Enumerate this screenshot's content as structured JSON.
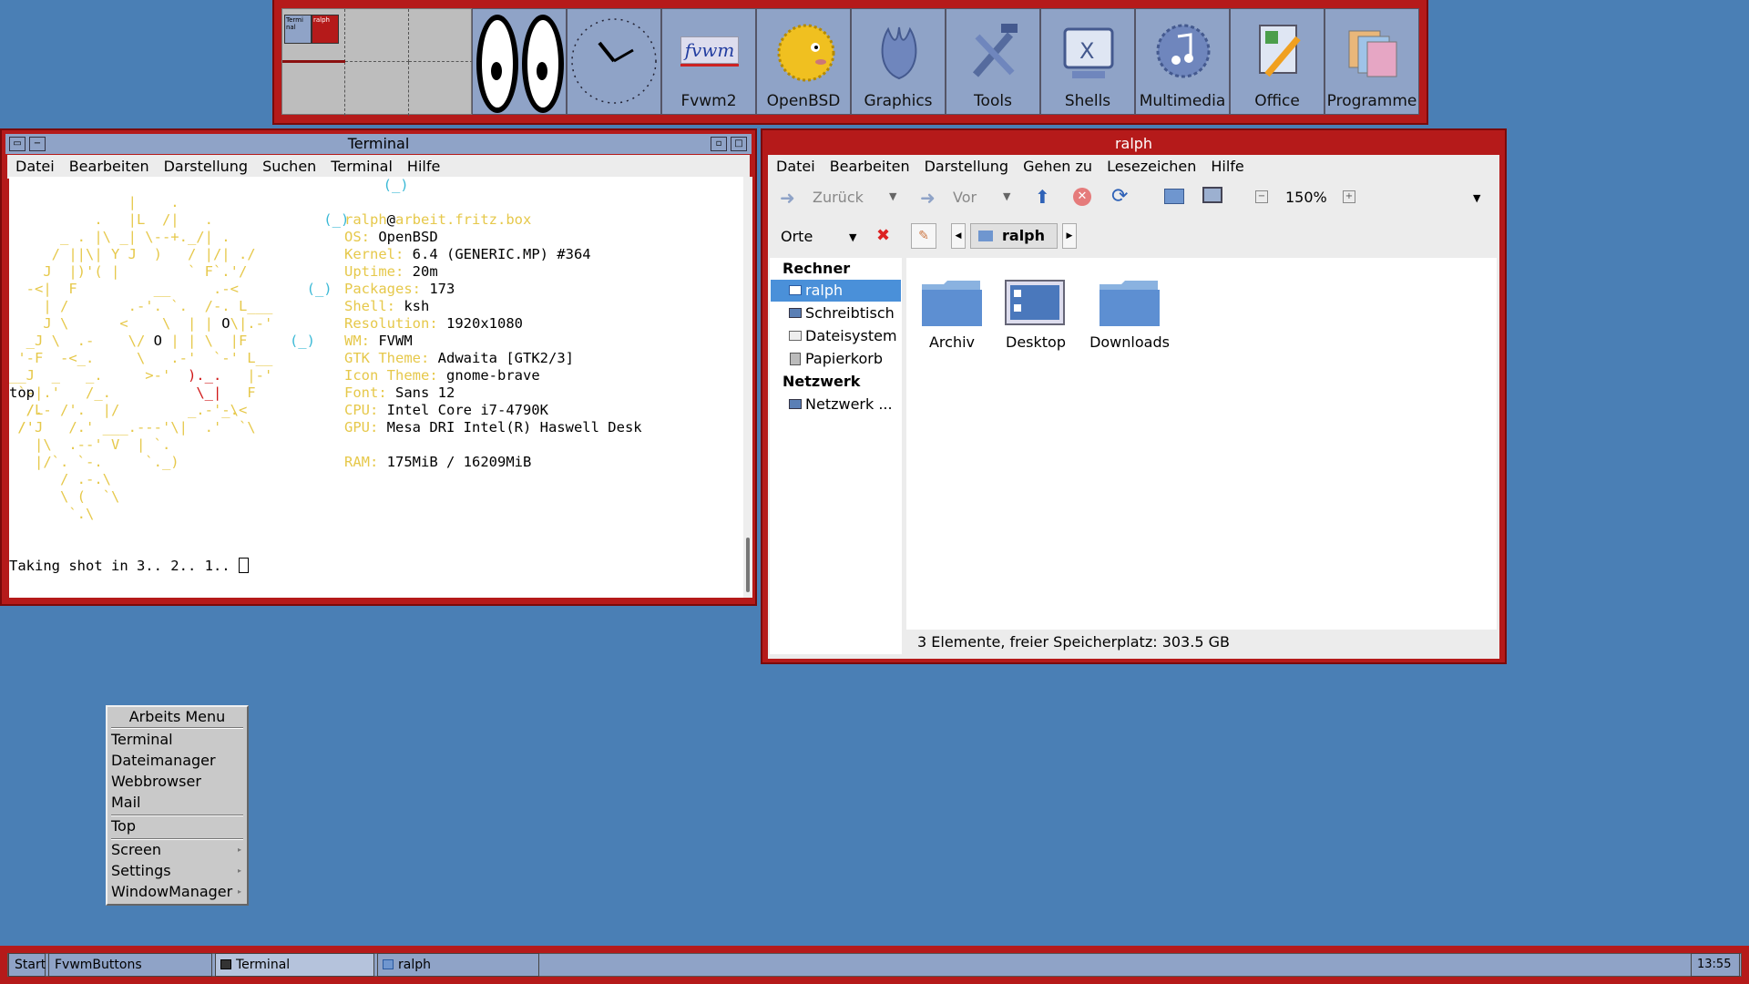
{
  "panel": {
    "pager": {
      "mini_terminal": "Termi nal",
      "mini_ralph": "ralph"
    },
    "buttons": [
      {
        "label": "Fvwm2",
        "icon": "fvwm-logo-icon"
      },
      {
        "label": "OpenBSD",
        "icon": "puffy-fish-icon"
      },
      {
        "label": "Graphics",
        "icon": "graphics-flower-icon"
      },
      {
        "label": "Tools",
        "icon": "tools-icon"
      },
      {
        "label": "Shells",
        "icon": "shells-monitor-icon"
      },
      {
        "label": "Multimedia",
        "icon": "multimedia-note-icon"
      },
      {
        "label": "Office",
        "icon": "office-pen-icon"
      },
      {
        "label": "Programme",
        "icon": "programs-folders-icon"
      }
    ],
    "fvwm_logo_text": "fvwm"
  },
  "terminal": {
    "title": "Terminal",
    "menu": [
      "Datei",
      "Bearbeiten",
      "Darstellung",
      "Suchen",
      "Terminal",
      "Hilfe"
    ],
    "header_user": "ralph",
    "header_at": "@",
    "header_host": "arbeit.fritz.box",
    "info": [
      {
        "key": "OS:",
        "value": "OpenBSD"
      },
      {
        "key": "Kernel:",
        "value": "6.4 (GENERIC.MP) #364"
      },
      {
        "key": "Uptime:",
        "value": "20m"
      },
      {
        "key": "Packages:",
        "value": "173"
      },
      {
        "key": "Shell:",
        "value": "ksh"
      },
      {
        "key": "Resolution:",
        "value": "1920x1080"
      },
      {
        "key": "WM:",
        "value": "FVWM"
      },
      {
        "key": "GTK Theme:",
        "value": "Adwaita [GTK2/3]"
      },
      {
        "key": "Icon Theme:",
        "value": "gnome-brave"
      },
      {
        "key": "Font:",
        "value": "Sans 12"
      },
      {
        "key": "CPU:",
        "value": "Intel Core i7-4790K"
      },
      {
        "key": "GPU:",
        "value": "Mesa DRI Intel(R) Haswell Desk"
      },
      {
        "key": "RAM:",
        "value": "175MiB / 16209MiB"
      }
    ],
    "top_line": "top",
    "prompt": "Taking shot in 3.. 2.. 1.. "
  },
  "filemanager": {
    "title": "ralph",
    "menu": [
      "Datei",
      "Bearbeiten",
      "Darstellung",
      "Gehen zu",
      "Lesezeichen",
      "Hilfe"
    ],
    "toolbar": {
      "back": "Zurück",
      "forward": "Vor",
      "zoom": "150%"
    },
    "places_label": "Orte",
    "path_button": "ralph",
    "sidebar": {
      "rechner_heading": "Rechner",
      "items": [
        "ralph",
        "Schreibtisch",
        "Dateisystem",
        "Papierkorb"
      ],
      "netzwerk_heading": "Netzwerk",
      "net_items": [
        "Netzwerk ..."
      ]
    },
    "files": [
      "Archiv",
      "Desktop",
      "Downloads"
    ],
    "status": "3 Elemente, freier Speicherplatz: 303.5 GB"
  },
  "menu": {
    "title": "Arbeits Menu",
    "group1": [
      "Terminal",
      "Dateimanager",
      "Webbrowser",
      "Mail"
    ],
    "group2": [
      "Top"
    ],
    "group3": [
      "Screen",
      "Settings",
      "WindowManager"
    ]
  },
  "taskbar": {
    "start": "Start",
    "items": [
      "FvwmButtons",
      "Terminal",
      "ralph"
    ],
    "clock": "13:55"
  },
  "colors": {
    "frame": "#b51a1a",
    "titlebar": "#8fa3c7",
    "desktop": "#4a7fb5"
  }
}
